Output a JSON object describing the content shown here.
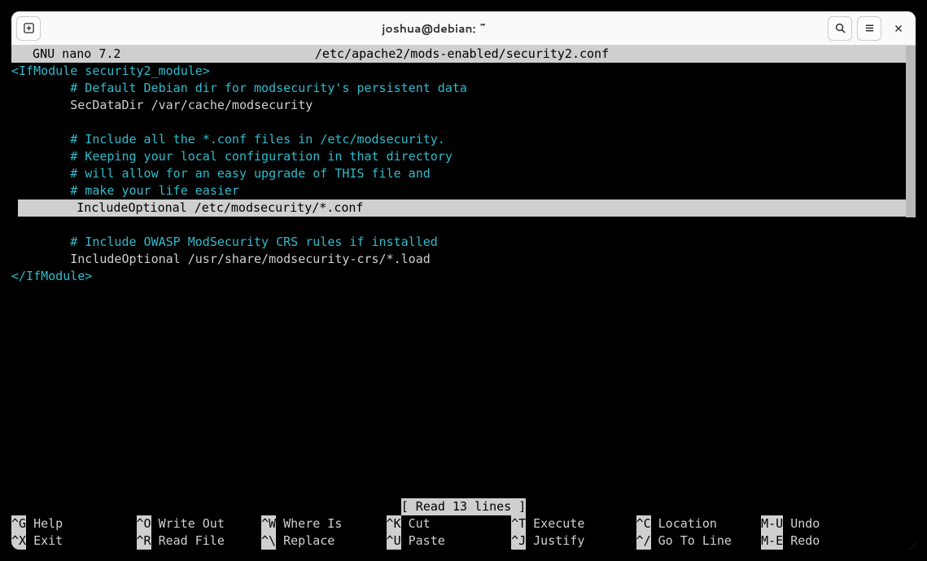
{
  "window": {
    "title": "joshua@debian: ~"
  },
  "nano": {
    "app": "  GNU nano 7.2",
    "file": "/etc/apache2/mods-enabled/security2.conf",
    "status": "[ Read 13 lines ]"
  },
  "code": {
    "l1a": "<IfModule security2_module>",
    "l2a": "        ",
    "l2b": "# Default Debian dir for modsecurity's persistent data",
    "l3a": "        SecDataDir /var/cache/modsecurity",
    "l4a": "        ",
    "l4b": "# Include all the *.conf files in /etc/modsecurity.",
    "l5a": "        ",
    "l5b": "# Keeping your local configuration in that directory",
    "l6a": "        ",
    "l6b": "# will allow for an easy upgrade of THIS file and",
    "l7a": "        ",
    "l7b": "# make your life easier",
    "l8a": "        IncludeOptional /etc/modsecurity/*.conf",
    "l9a": "        ",
    "l9b": "# Include OWASP ModSecurity CRS rules if installed",
    "l10a": "        IncludeOptional /usr/share/modsecurity-crs/*.load",
    "l11a": "</IfModule>"
  },
  "shortcuts": {
    "r1": {
      "c1k": "^G",
      "c1l": "Help",
      "c2k": "^O",
      "c2l": "Write Out",
      "c3k": "^W",
      "c3l": "Where Is",
      "c4k": "^K",
      "c4l": "Cut",
      "c5k": "^T",
      "c5l": "Execute",
      "c6k": "^C",
      "c6l": "Location",
      "c7k": "M-U",
      "c7l": "Undo"
    },
    "r2": {
      "c1k": "^X",
      "c1l": "Exit",
      "c2k": "^R",
      "c2l": "Read File",
      "c3k": "^\\",
      "c3l": "Replace",
      "c4k": "^U",
      "c4l": "Paste",
      "c5k": "^J",
      "c5l": "Justify",
      "c6k": "^/",
      "c6l": "Go To Line",
      "c7k": "M-E",
      "c7l": "Redo"
    }
  }
}
